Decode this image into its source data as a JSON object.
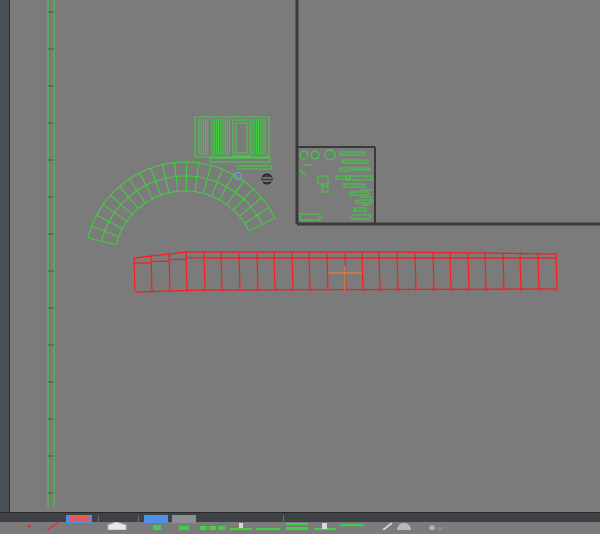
{
  "colors": {
    "viewport_bg": "#7b7b7b",
    "wire_green": "#3fd23f",
    "selection_red": "#ff1a1a",
    "frame_dark": "#3a3a3a",
    "toolbar_bg": "#3e4246",
    "toolbar_active": "#4f8fe6"
  },
  "toolbar": {
    "tools": [
      "select-tool-icon",
      "line-tool-icon",
      "fill-color-swatch",
      "box-tool-icon",
      "add-layer-icon",
      "remove-layer-icon",
      "grid-toggle-icon",
      "align-icon",
      "dimension-icon",
      "snap-icon",
      "measure-icon",
      "pen-icon",
      "sphere-icon",
      "material-icon"
    ]
  }
}
